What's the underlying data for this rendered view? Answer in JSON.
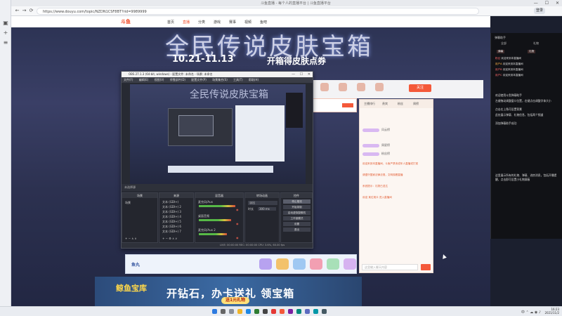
{
  "browser": {
    "tab_title": "斗鱼直播 - 每个人的直播平台 | 斗鱼直播平台",
    "address": "https://www.douyu.com/topic/NZDN1CSF8BT?rid=9989999",
    "profile_label": "登录",
    "nav_back": "←",
    "nav_forward": "→",
    "nav_reload": "⟳",
    "window_min": "—",
    "window_max": "☐",
    "window_close": "✕"
  },
  "site": {
    "logo": "斗鱼",
    "nav": [
      "首页",
      "直播",
      "分类",
      "游戏",
      "赛事",
      "视频",
      "鱼吧"
    ],
    "banner_title": "全民传说皮肤宝箱",
    "banner_dates": "10.21-11.13",
    "banner_sub": "开箱得皮肤点券",
    "follow_label": "关注"
  },
  "obs": {
    "title": "OBS 27.1.3 (64-bit, windows) - 配置文件: 未命名 - 场景: 未命名",
    "menu": [
      "文件(F)",
      "编辑(E)",
      "视图(V)",
      "停靠部件(D)",
      "配置文件(P)",
      "场景集合(S)",
      "工具(T)",
      "帮助(H)"
    ],
    "status_text": "未选择源",
    "docks": {
      "scenes_header": "场景",
      "scene_item": "场景",
      "sources_header": "来源",
      "sources": [
        "文本 (GDI+)",
        "文本 (GDI+) 2",
        "文本 (GDI+) 3",
        "文本 (GDI+) 4",
        "文本 (GDI+) 5",
        "文本 (GDI+) 6",
        "文本 (GDI+) 7"
      ],
      "mixer_header": "混音器",
      "mixer_tracks": [
        "麦克风/Aux",
        "桌面音频",
        "麦克风/Aux 2"
      ],
      "transitions_header": "转场动画",
      "transition_type": "淡出",
      "duration_label": "时长",
      "duration_value": "300 ms",
      "controls_header": "控件",
      "controls": [
        "停止推流",
        "开始录制",
        "启动虚拟摄像机",
        "工作室模式",
        "设置",
        "退出"
      ]
    },
    "footer": "LIVE: 00:00:00   REC: 00:00:00   CPU: 3.6%, 60.00 fps"
  },
  "site_chat": {
    "tabs": [
      "主播排行",
      "贵宾",
      "粉丝",
      "周榜"
    ],
    "ranks": [
      "风云榜",
      "周星榜",
      "粉丝榜"
    ],
    "lines": [
      "欢迎来到本直播间，斗鱼严禁未成年人直播或打赏",
      "请遵守国家法律法规，文明观看直播",
      "系统提示：礼物已送达",
      "欢迎 某位观众 进入直播间"
    ],
    "input_placeholder": "这里输入聊天内容"
  },
  "gift_bar": {
    "label": "鱼丸"
  },
  "ad": {
    "logo": "鲸鱼宝库",
    "text": "开钻石，办卡送礼 领宝箱",
    "pill": "送1元礼物"
  },
  "overlay": {
    "title": "弹幕助手",
    "tabs": [
      "全部",
      "礼物"
    ],
    "badges": [
      "弹幕",
      "礼物"
    ],
    "messages": [
      {
        "user": "粉丝",
        "text": "欢迎来到本直播间",
        "color": "#ff6a6a"
      },
      {
        "user": "用户A",
        "text": "欢迎来到本直播间",
        "color": "#ffb347"
      },
      {
        "user": "用户B",
        "text": "欢迎来到本直播间",
        "color": "#ff6a6a"
      },
      {
        "user": "用户C",
        "text": "欢迎来到本直播间",
        "color": "#ff6a6a"
      }
    ],
    "notes": [
      "欢迎使用斗鱼弹幕助手",
      "左键拖动调整窗口位置，右键点击调整字体大小",
      "点击右上角可设置背景",
      "此处展示弹幕、礼物信息，包括两个频道",
      "添加弹幕助手成功"
    ],
    "footer_note": "这里展示所有的礼物、弹幕、进房消息，包括开播提醒，点击即可设置小礼物屏蔽"
  },
  "taskbar": {
    "time": "16:23",
    "date": "2021/11/2",
    "tray": "中 ⌃ ☁ ◉ ♪"
  },
  "colors": {
    "accent": "#f4593a",
    "obs_bg": "#272a33",
    "overlay_bg": "#111216"
  }
}
